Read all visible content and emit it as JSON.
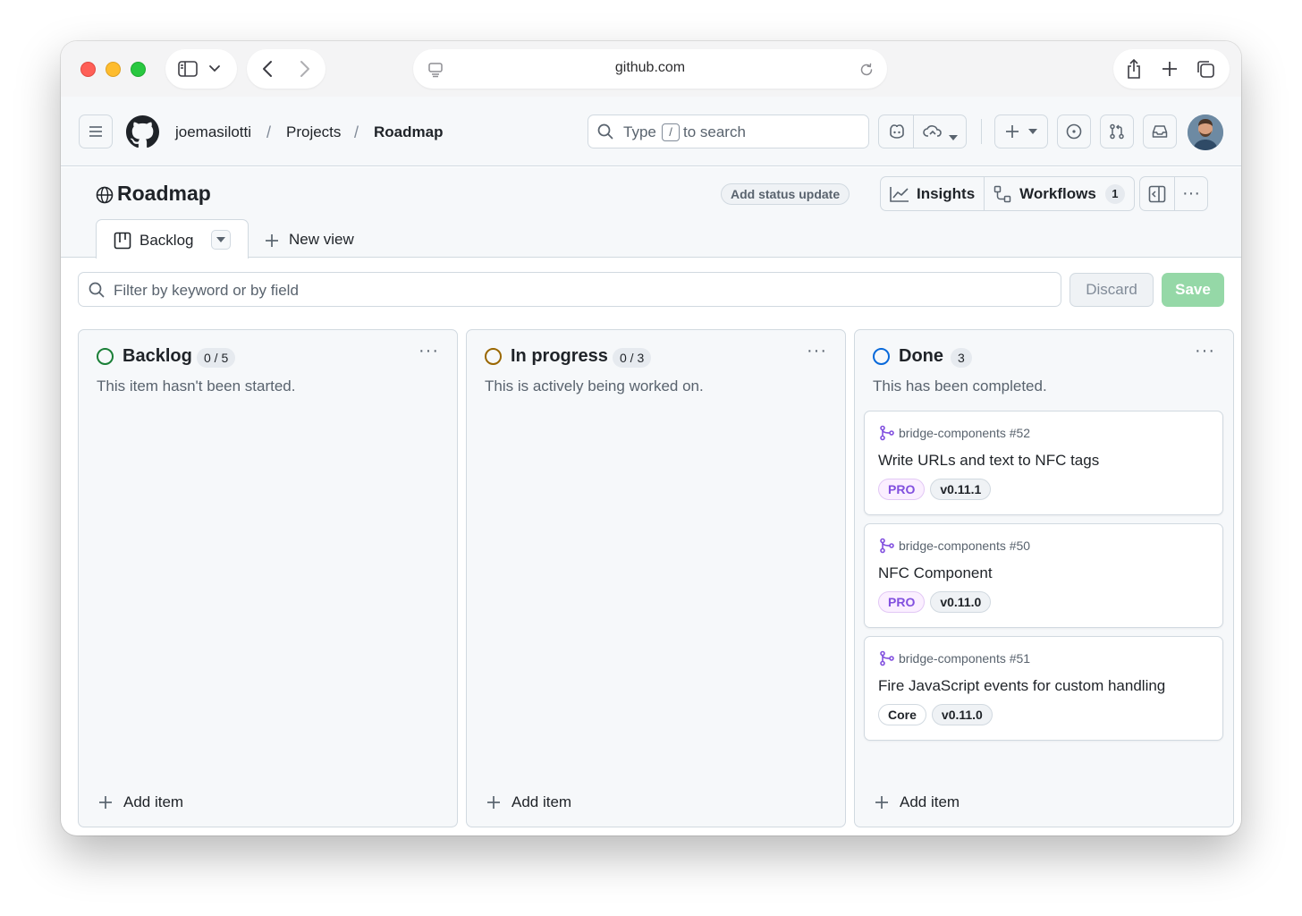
{
  "browser": {
    "url": "github.com"
  },
  "header": {
    "breadcrumb": [
      {
        "label": "joemasilotti"
      },
      {
        "label": "Projects"
      },
      {
        "label": "Roadmap"
      }
    ],
    "search": {
      "prefix": "Type",
      "key": "/",
      "suffix": "to search"
    }
  },
  "project": {
    "title": "Roadmap",
    "status_update": "Add status update",
    "insights": "Insights",
    "workflows": "Workflows",
    "workflows_count": "1",
    "tabs": [
      {
        "label": "Backlog"
      }
    ],
    "new_view": "New view",
    "filter_placeholder": "Filter by keyword or by field",
    "discard": "Discard",
    "save": "Save"
  },
  "colors": {
    "backlog": "#1a7f37",
    "in_progress": "#9a6700",
    "done": "#0969da",
    "pro_label": "#8250df",
    "pr_icon": "#8250df"
  },
  "columns": [
    {
      "title": "Backlog",
      "count": "0 / 5",
      "description": "This item hasn't been started.",
      "add_item": "Add item",
      "cards": []
    },
    {
      "title": "In progress",
      "count": "0 / 3",
      "description": "This is actively being worked on.",
      "add_item": "Add item",
      "cards": []
    },
    {
      "title": "Done",
      "count": "3",
      "description": "This has been completed.",
      "add_item": "Add item",
      "cards": [
        {
          "repo": "bridge-components #52",
          "title": "Write URLs and text to NFC tags",
          "labels": [
            "PRO",
            "v0.11.1"
          ]
        },
        {
          "repo": "bridge-components #50",
          "title": "NFC Component",
          "labels": [
            "PRO",
            "v0.11.0"
          ]
        },
        {
          "repo": "bridge-components #51",
          "title": "Fire JavaScript events for custom handling",
          "labels": [
            "Core",
            "v0.11.0"
          ]
        }
      ]
    }
  ]
}
